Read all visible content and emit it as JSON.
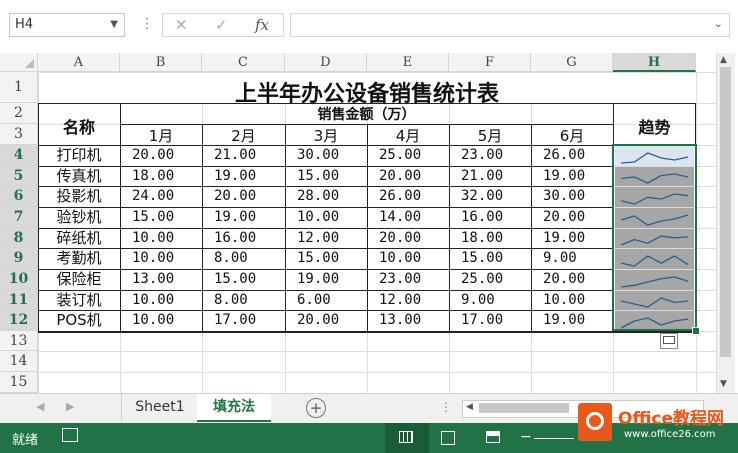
{
  "formula_bar": {
    "name_box": "H4",
    "cancel_icon": "✕",
    "enter_icon": "✓",
    "fx_icon": "fx",
    "formula": ""
  },
  "columns": [
    "A",
    "B",
    "C",
    "D",
    "E",
    "F",
    "G",
    "H"
  ],
  "selected_column": "H",
  "rows": [
    "1",
    "2",
    "3",
    "4",
    "5",
    "6",
    "7",
    "8",
    "9",
    "10",
    "11",
    "12",
    "13",
    "14",
    "15"
  ],
  "selected_rows": [
    "4",
    "5",
    "6",
    "7",
    "8",
    "9",
    "10",
    "11",
    "12"
  ],
  "table": {
    "title": "上半年办公设备销售统计表",
    "name_header": "名称",
    "amount_header": "销售金额（万）",
    "trend_header": "趋势",
    "months": [
      "1月",
      "2月",
      "3月",
      "4月",
      "5月",
      "6月"
    ],
    "data": [
      {
        "name": "打印机",
        "values": [
          "20.00",
          "21.00",
          "30.00",
          "25.00",
          "23.00",
          "26.00"
        ],
        "series": [
          20,
          21,
          30,
          25,
          23,
          26
        ]
      },
      {
        "name": "传真机",
        "values": [
          "18.00",
          "19.00",
          "15.00",
          "20.00",
          "21.00",
          "19.00"
        ],
        "series": [
          18,
          19,
          15,
          20,
          21,
          19
        ]
      },
      {
        "name": "投影机",
        "values": [
          "24.00",
          "20.00",
          "28.00",
          "26.00",
          "32.00",
          "30.00"
        ],
        "series": [
          24,
          20,
          28,
          26,
          32,
          30
        ]
      },
      {
        "name": "验钞机",
        "values": [
          "15.00",
          "19.00",
          "10.00",
          "14.00",
          "16.00",
          "20.00"
        ],
        "series": [
          15,
          19,
          10,
          14,
          16,
          20
        ]
      },
      {
        "name": "碎纸机",
        "values": [
          "10.00",
          "16.00",
          "12.00",
          "20.00",
          "18.00",
          "19.00"
        ],
        "series": [
          10,
          16,
          12,
          20,
          18,
          19
        ]
      },
      {
        "name": "考勤机",
        "values": [
          "10.00",
          "8.00",
          "15.00",
          "10.00",
          "15.00",
          "9.00"
        ],
        "series": [
          10,
          8,
          15,
          10,
          15,
          9
        ]
      },
      {
        "name": "保险柜",
        "values": [
          "13.00",
          "15.00",
          "19.00",
          "23.00",
          "25.00",
          "20.00"
        ],
        "series": [
          13,
          15,
          19,
          23,
          25,
          20
        ]
      },
      {
        "name": "装订机",
        "values": [
          "10.00",
          "8.00",
          "6.00",
          "12.00",
          "9.00",
          "10.00"
        ],
        "series": [
          10,
          8,
          6,
          12,
          9,
          10
        ]
      },
      {
        "name": "POS机",
        "values": [
          "10.00",
          "17.00",
          "20.00",
          "13.00",
          "17.00",
          "19.00"
        ],
        "series": [
          10,
          17,
          20,
          13,
          17,
          19
        ]
      }
    ]
  },
  "sheet_tabs": [
    "Sheet1",
    "填充法"
  ],
  "active_tab": "填充法",
  "status": {
    "ready": "就绪"
  },
  "watermark": {
    "brand": "Office教程网",
    "url": "www.office26.com"
  },
  "colors": {
    "accent": "#217346",
    "spark_line": "#2e5d8c",
    "spark_bg": "#a6a6a6"
  }
}
